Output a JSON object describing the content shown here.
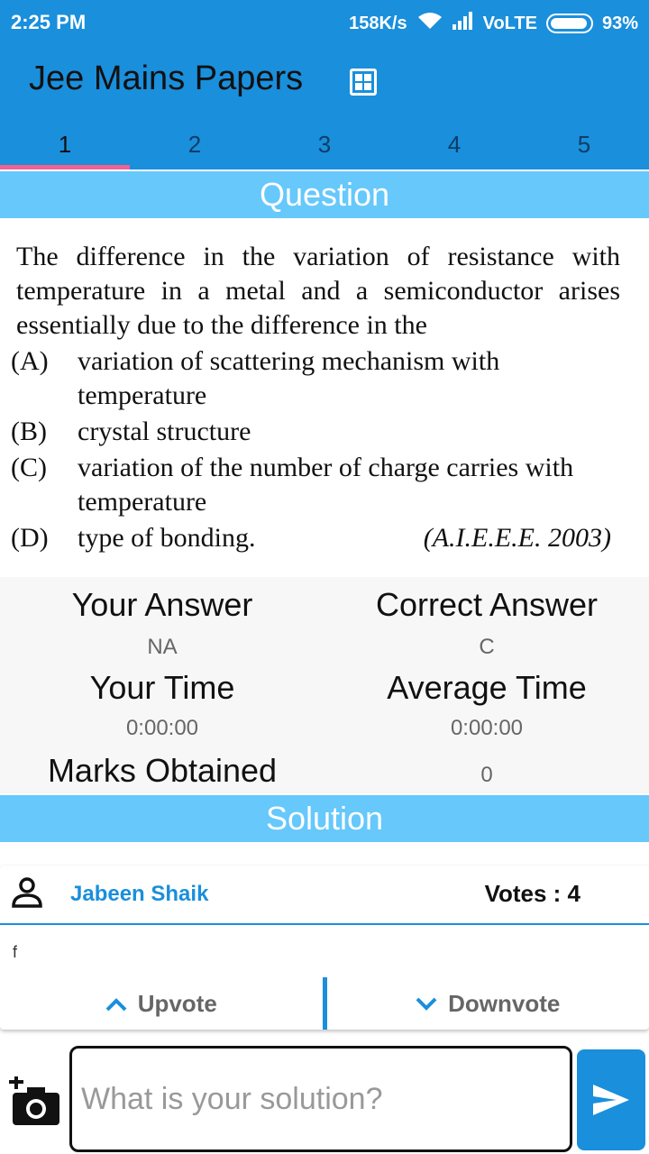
{
  "status_bar": {
    "time": "2:25 PM",
    "speed": "158K/s",
    "network": "VoLTE",
    "battery": "93%"
  },
  "app_bar": {
    "title": "Jee Mains Papers",
    "icon": "calculator-icon"
  },
  "tabs": [
    {
      "label": "1",
      "active": true
    },
    {
      "label": "2",
      "active": false
    },
    {
      "label": "3",
      "active": false
    },
    {
      "label": "4",
      "active": false
    },
    {
      "label": "5",
      "active": false
    }
  ],
  "question_header": "Question",
  "question": {
    "stem": "The difference in the variation of resistance with temperature in a metal and a semiconductor arises essentially due to the difference in the",
    "options": [
      {
        "label": "(A)",
        "text": "variation of scattering mechanism with temperature"
      },
      {
        "label": "(B)",
        "text": "crystal structure"
      },
      {
        "label": "(C)",
        "text": "variation of the number of charge carries with temperature"
      },
      {
        "label": "(D)",
        "text": "type of bonding."
      }
    ],
    "source": "(A.I.E.E.E. 2003)"
  },
  "results": {
    "your_answer_label": "Your Answer",
    "your_answer_value": "NA",
    "correct_answer_label": "Correct Answer",
    "correct_answer_value": "C",
    "your_time_label": "Your Time",
    "your_time_value": "0:00:00",
    "average_time_label": "Average Time",
    "average_time_value": "0:00:00",
    "marks_label": "Marks Obtained",
    "marks_value": "0"
  },
  "solution_header": "Solution",
  "solution_card": {
    "author": "Jabeen Shaik",
    "votes": "Votes : 4",
    "text": "f",
    "upvote_label": "Upvote",
    "downvote_label": "Downvote"
  },
  "composer": {
    "placeholder": "What is your solution?"
  },
  "colors": {
    "primary": "#1a8fdc",
    "header_light": "#66c8fb",
    "tab_indicator": "#f06292"
  }
}
